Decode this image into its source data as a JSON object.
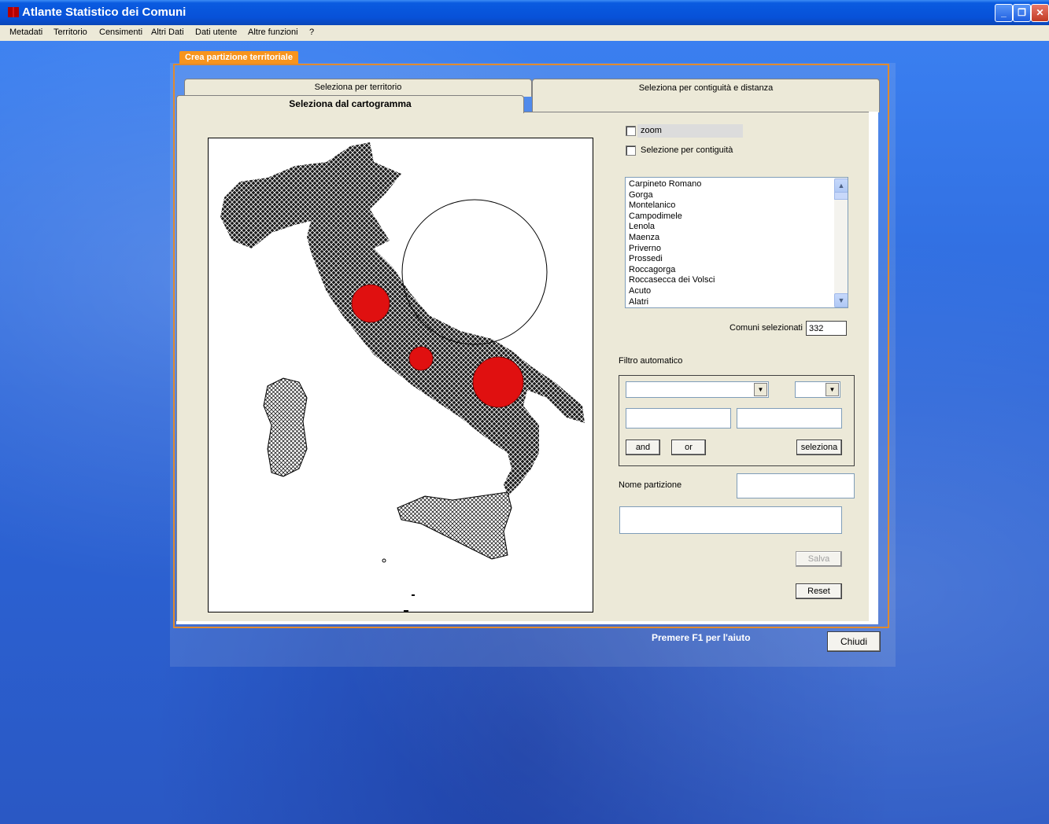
{
  "window": {
    "title": "Atlante Statistico dei Comuni",
    "minimize_icon": "minimize-icon",
    "restore_icon": "restore-icon",
    "close_icon": "close-icon"
  },
  "menu": [
    "Metadati",
    "Territorio",
    "Censimenti",
    "Altri Dati",
    "Dati utente",
    "Altre funzioni",
    "?"
  ],
  "dialog": {
    "title": "Crea partizione territoriale",
    "tabs": {
      "territorio": "Seleziona per territorio",
      "contiguita": "Seleziona per contiguità e distanza",
      "cartogramma": "Seleziona dal cartogramma"
    },
    "options": {
      "zoom_label": "zoom",
      "zoom_checked": false,
      "contiguita_label": "Selezione per contiguità",
      "contiguita_checked": false
    },
    "comuni_list": [
      "Carpineto Romano",
      "Gorga",
      "Montelanico",
      "Campodimele",
      "Lenola",
      "Maenza",
      "Priverno",
      "Prossedi",
      "Roccagorga",
      "Roccasecca dei Volsci",
      "Acuto",
      "Alatri"
    ],
    "comuni_selezionati_label": "Comuni selezionati",
    "comuni_selezionati_value": "332",
    "filtro": {
      "label": "Filtro automatico",
      "select1_value": "",
      "select2_value": "",
      "input1_value": "",
      "input2_value": "",
      "and_label": "and",
      "or_label": "or",
      "seleziona_label": "seleziona"
    },
    "nome_partizione_label": "Nome partizione",
    "nome_partizione_value": "",
    "descrizione_value": "",
    "salva_label": "Salva",
    "reset_label": "Reset"
  },
  "footer": {
    "help": "Premere F1 per l'aiuto",
    "chiudi": "Chiudi"
  },
  "colors": {
    "selection_red": "#e01010",
    "dialog_accent": "#f7941d",
    "titlebar_blue": "#0751d8"
  }
}
